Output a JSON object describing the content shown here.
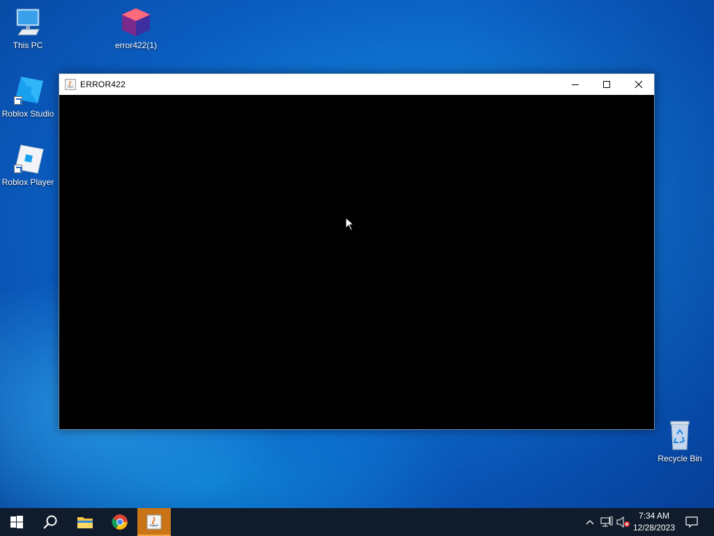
{
  "desktop": {
    "icons": [
      {
        "label": "This PC",
        "icon": "computer-icon"
      },
      {
        "label": "error422(1)",
        "icon": "cube-icon"
      },
      {
        "label": "Roblox Studio",
        "icon": "roblox-studio-icon"
      },
      {
        "label": "Roblox Player",
        "icon": "roblox-player-icon"
      },
      {
        "label": "Recycle Bin",
        "icon": "recycle-bin-icon"
      }
    ]
  },
  "window": {
    "title": "ERROR422",
    "icon": "java-icon",
    "background": "#000000"
  },
  "taskbar": {
    "items": [
      {
        "name": "start",
        "icon": "windows-logo-icon"
      },
      {
        "name": "search",
        "icon": "search-icon"
      },
      {
        "name": "file-explorer",
        "icon": "folder-icon"
      },
      {
        "name": "chrome",
        "icon": "chrome-icon"
      },
      {
        "name": "java-app",
        "icon": "java-icon",
        "active": true
      }
    ],
    "tray": {
      "time": "7:34 AM",
      "date": "12/28/2023"
    },
    "accent": "#c87417"
  }
}
